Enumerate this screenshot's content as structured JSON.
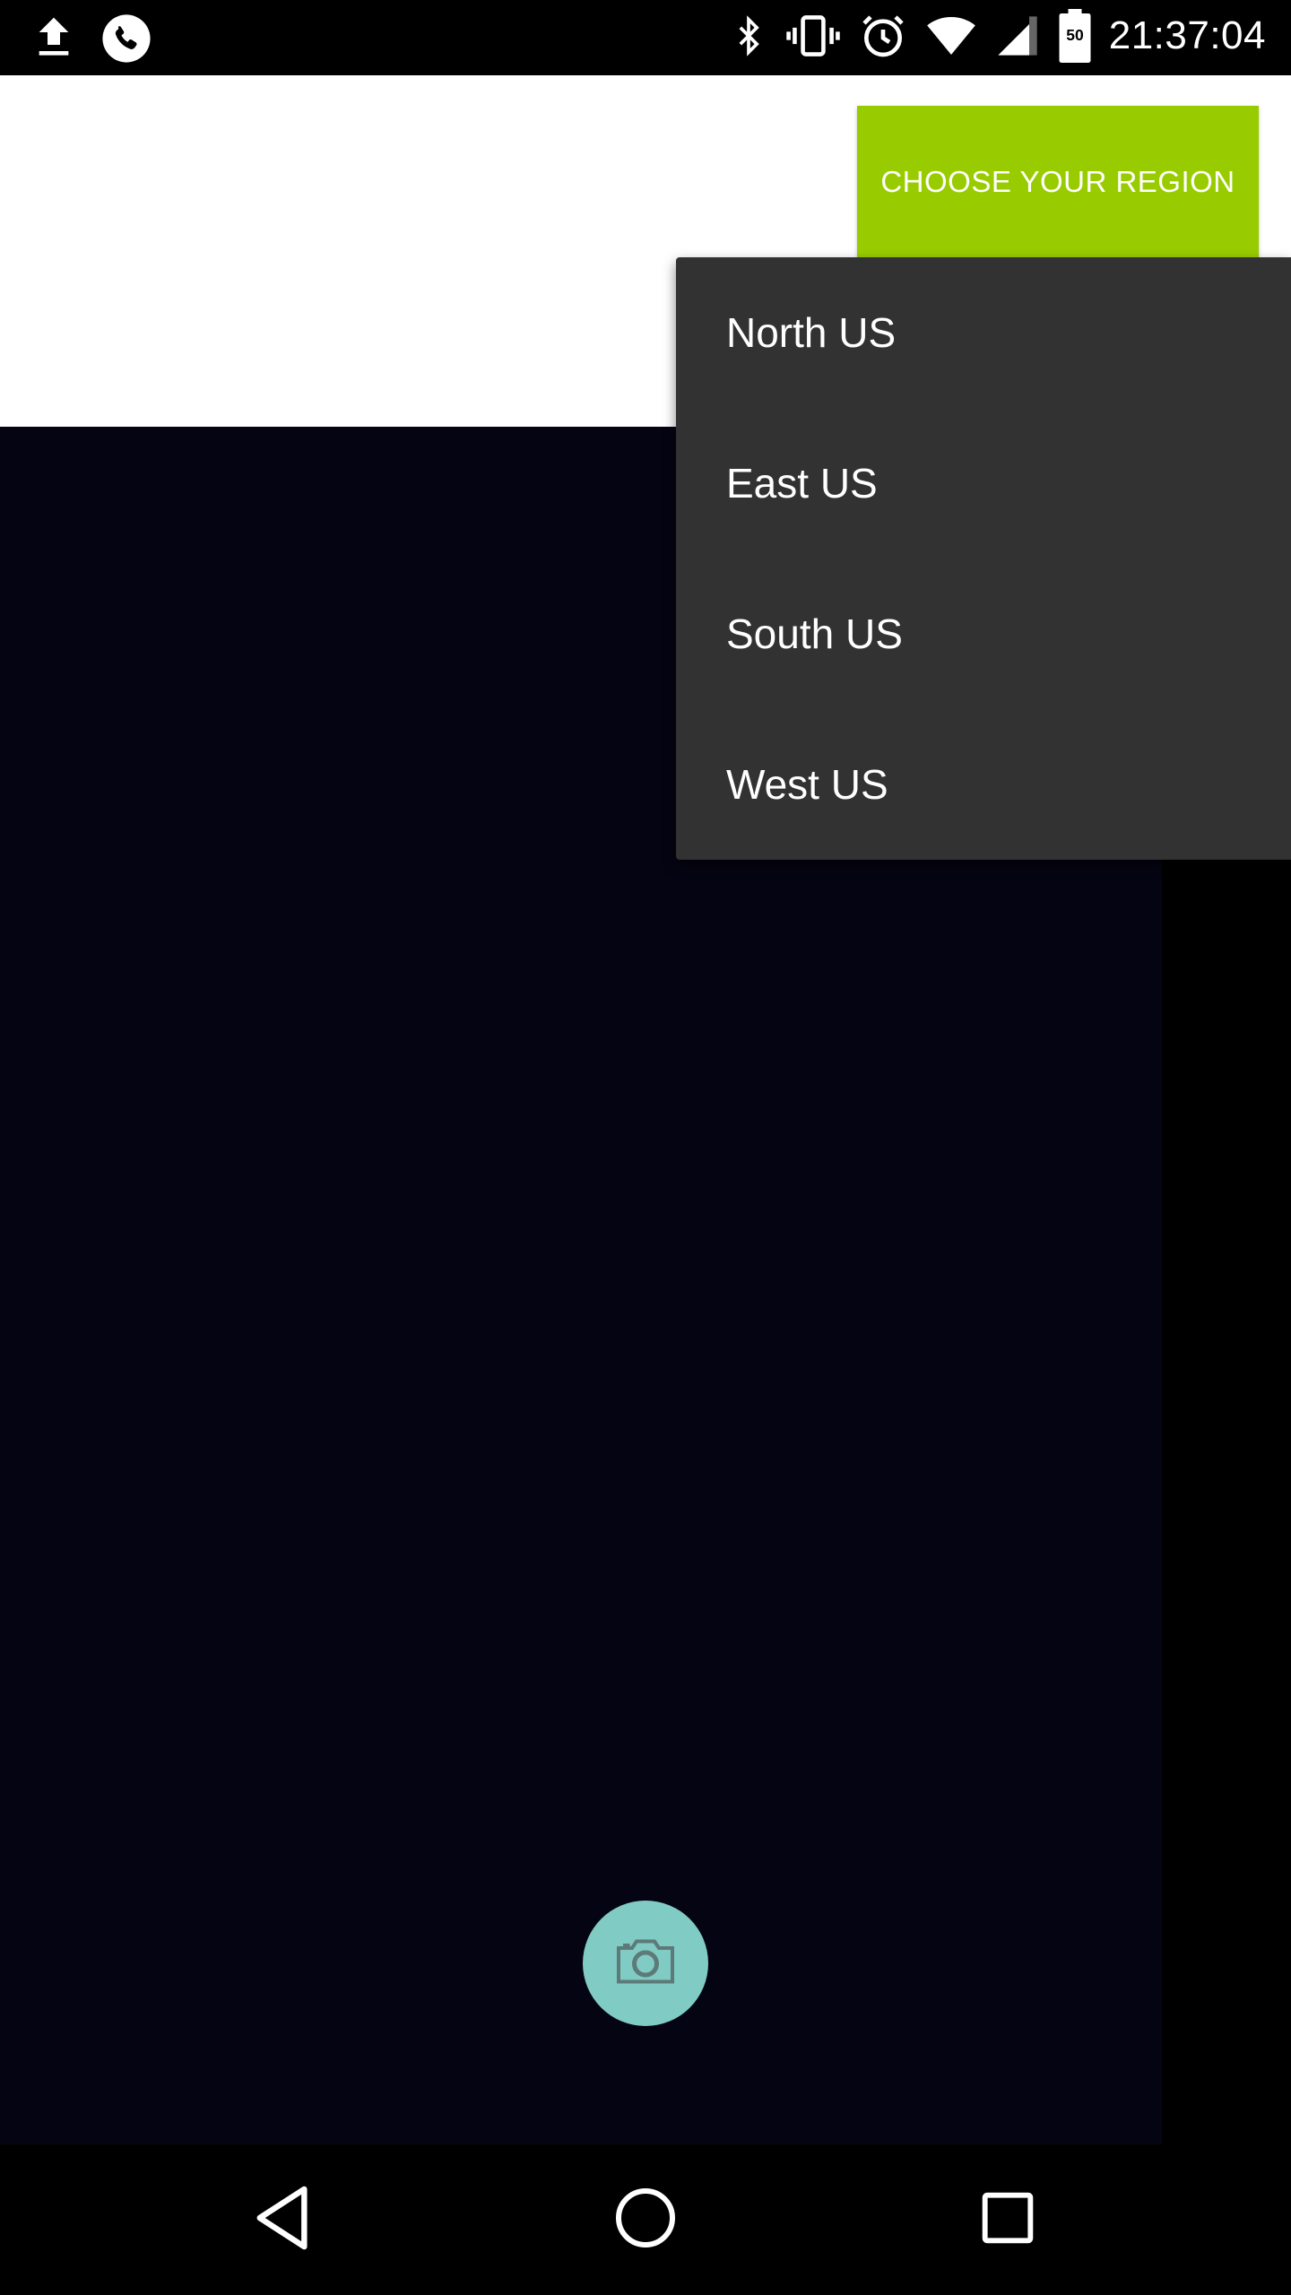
{
  "status_bar": {
    "time": "21:37:04",
    "battery_level": "50",
    "left_icons": [
      "upload-icon",
      "phone-call-icon"
    ],
    "right_icons": [
      "bluetooth-icon",
      "vibrate-icon",
      "alarm-icon",
      "wifi-icon",
      "cell-signal-icon",
      "battery-icon"
    ]
  },
  "header": {
    "region_button_label": "CHOOSE YOUR REGION",
    "region_button_color": "#99cc00"
  },
  "dropdown": {
    "items": [
      {
        "label": "North US"
      },
      {
        "label": "East US"
      },
      {
        "label": "South US"
      },
      {
        "label": "West US"
      }
    ]
  },
  "camera_fab": {
    "icon": "camera-icon",
    "color": "#80cbc4"
  },
  "nav_bar": {
    "buttons": [
      "back-icon",
      "home-icon",
      "recents-icon"
    ]
  }
}
